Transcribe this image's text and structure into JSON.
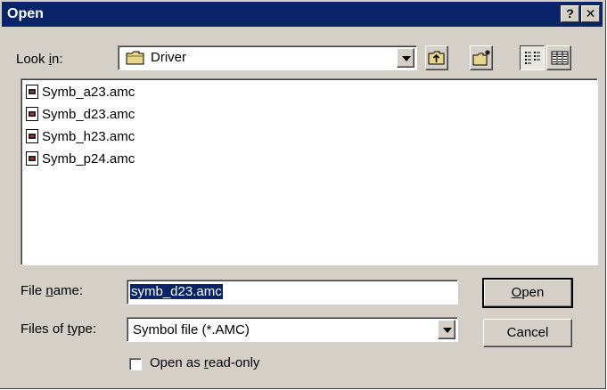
{
  "window": {
    "title": "Open",
    "help_button": "?",
    "close_button": "✕"
  },
  "look_in": {
    "label_pre": "Look ",
    "label_accel": "i",
    "label_post": "n:",
    "value": "Driver"
  },
  "toolbar": {
    "up_folder_icon": "up-folder-icon",
    "new_folder_icon": "new-folder-icon",
    "list_view_icon": "list-view-icon",
    "details_view_icon": "details-view-icon",
    "active_view": "list"
  },
  "files": [
    {
      "name": "Symb_a23.amc"
    },
    {
      "name": "Symb_d23.amc"
    },
    {
      "name": "Symb_h23.amc"
    },
    {
      "name": "Symb_p24.amc"
    }
  ],
  "file_name": {
    "label_pre": "File ",
    "label_accel": "n",
    "label_post": "ame:",
    "value": "symb_d23.amc"
  },
  "file_type": {
    "label_pre": "Files of ",
    "label_accel": "t",
    "label_post": "ype:",
    "value": "Symbol file (*.AMC)"
  },
  "buttons": {
    "open_accel": "O",
    "open_rest": "pen",
    "cancel": "Cancel"
  },
  "read_only": {
    "label_pre": "Open as ",
    "label_accel": "r",
    "label_post": "ead-only",
    "checked": false
  },
  "colors": {
    "titlebar": "#0a246a",
    "face": "#d4d0c8",
    "selection": "#0a246a"
  }
}
